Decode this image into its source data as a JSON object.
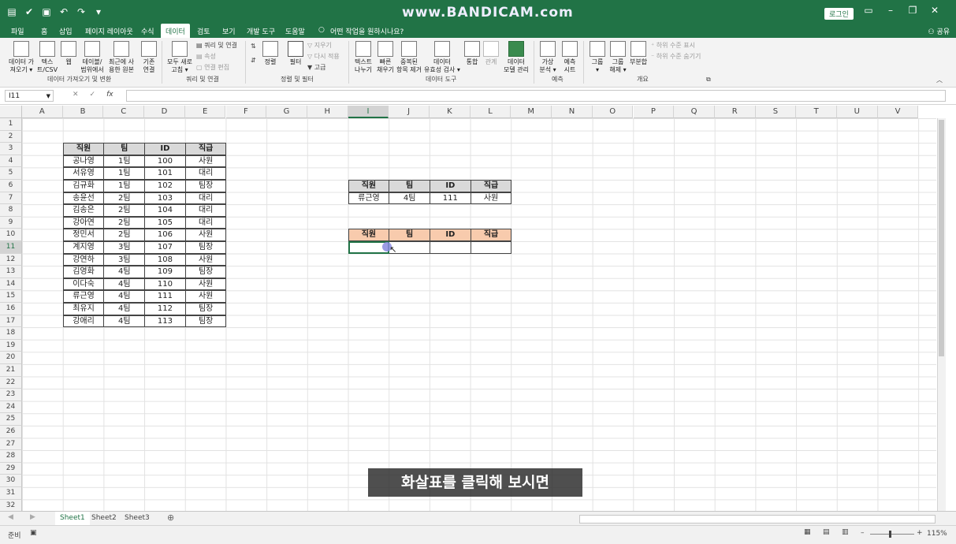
{
  "titlebar": {
    "watermark": "www.BANDICAM.com",
    "login": "로그인"
  },
  "ribbon_tabs": [
    "파일",
    "홈",
    "삽입",
    "페이지 레이아웃",
    "수식",
    "데이터",
    "검토",
    "보기",
    "개발 도구",
    "도움말"
  ],
  "active_tab": "데이터",
  "tell_me": "어떤 작업을 원하시나요?",
  "share_label": "공유",
  "ribbon": {
    "get_data": "데이터 가\n져오기 ▾",
    "text_csv": "텍스\n트/CSV",
    "web": "웹",
    "table_range": "테이블/\n범위에서",
    "recent_sources": "최근에 사\n용한 원본",
    "existing_conn": "기존\n연결",
    "group_get": "데이터 가져오기 및 변환",
    "refresh_all": "모두 새로\n고침 ▾",
    "queries_conn": "쿼리 및 연결",
    "properties": "속성",
    "edit_links": "연결 편집",
    "group_queries": "쿼리 및 연결",
    "sort": "정렬",
    "filter": "필터",
    "clear": "지우기",
    "reapply": "다시 적용",
    "advanced": "고급",
    "group_sort": "정렬 및 필터",
    "text_to_columns": "텍스트\n나누기",
    "flash_fill": "빠른\n채우기",
    "remove_dup": "중복된\n항목 제거",
    "data_validation": "데이터\n유효성 검사 ▾",
    "consolidate": "통합",
    "relationships": "관계",
    "data_model": "데이터\n모델 관리",
    "group_tools": "데이터 도구",
    "what_if": "가상\n분석 ▾",
    "forecast_sheet": "예측\n시트",
    "group_forecast": "예측",
    "group_btn": "그룹\n▾",
    "ungroup_btn": "그룹\n해제 ▾",
    "subtotal": "부분합",
    "show_detail": "하위 수준 표시",
    "hide_detail": "하위 수준 숨기기",
    "group_outline": "개요"
  },
  "name_box": "I11",
  "fx_label": "fx",
  "columns": [
    "A",
    "B",
    "C",
    "D",
    "E",
    "F",
    "G",
    "H",
    "I",
    "J",
    "K",
    "L",
    "M",
    "N",
    "O",
    "P",
    "Q",
    "R",
    "S",
    "T",
    "U",
    "V"
  ],
  "rows": [
    "1",
    "2",
    "3",
    "4",
    "5",
    "6",
    "7",
    "8",
    "9",
    "10",
    "11",
    "12",
    "13",
    "14",
    "15",
    "16",
    "17",
    "18",
    "19",
    "20",
    "21",
    "22",
    "23",
    "24",
    "25",
    "26",
    "27",
    "28",
    "29",
    "30",
    "31",
    "32"
  ],
  "table_main": {
    "headers": [
      "직원",
      "팀",
      "ID",
      "직급"
    ],
    "rows": [
      [
        "공나영",
        "1팀",
        "100",
        "사원"
      ],
      [
        "서유영",
        "1팀",
        "101",
        "대리"
      ],
      [
        "김규화",
        "1팀",
        "102",
        "팀장"
      ],
      [
        "송윤선",
        "2팀",
        "103",
        "대리"
      ],
      [
        "김송은",
        "2팀",
        "104",
        "대리"
      ],
      [
        "강아연",
        "2팀",
        "105",
        "대리"
      ],
      [
        "정민서",
        "2팀",
        "106",
        "사원"
      ],
      [
        "계지영",
        "3팀",
        "107",
        "팀장"
      ],
      [
        "강연하",
        "3팀",
        "108",
        "사원"
      ],
      [
        "김영화",
        "4팀",
        "109",
        "팀장"
      ],
      [
        "이다숙",
        "4팀",
        "110",
        "사원"
      ],
      [
        "류근영",
        "4팀",
        "111",
        "사원"
      ],
      [
        "최유지",
        "4팀",
        "112",
        "팀장"
      ],
      [
        "강애리",
        "4팀",
        "113",
        "팀장"
      ]
    ]
  },
  "table_lookup": {
    "headers": [
      "직원",
      "팀",
      "ID",
      "직급"
    ],
    "row": [
      "류근영",
      "4팀",
      "111",
      "사원"
    ]
  },
  "table_filter": {
    "headers": [
      "직원",
      "팀",
      "ID",
      "직급"
    ]
  },
  "sheets": [
    "Sheet1",
    "Sheet2",
    "Sheet3"
  ],
  "status": {
    "ready": "준비",
    "zoom": "115%"
  },
  "subtitle": "화살표를 클릭해 보시면"
}
